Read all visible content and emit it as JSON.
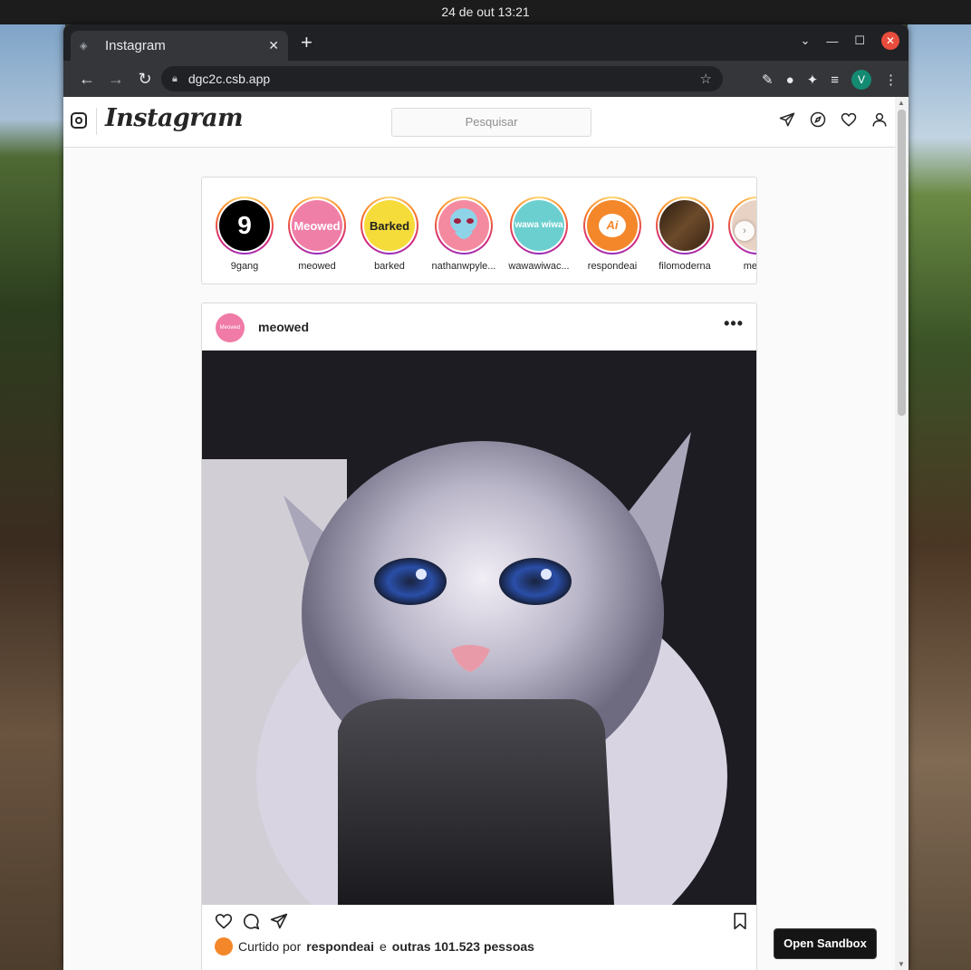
{
  "system": {
    "clock": "24 de out  13:21"
  },
  "browser": {
    "tab_title": "Instagram",
    "tab_close": "✕",
    "new_tab": "+",
    "url": "dgc2c.csb.app",
    "profile_initial": "V"
  },
  "instagram": {
    "brand": "Instagram",
    "search_placeholder": "Pesquisar",
    "stories": [
      {
        "name": "9gang",
        "label": "9",
        "bg": "#000000"
      },
      {
        "name": "meowed",
        "label": "Meowed",
        "bg": "#f07fa8"
      },
      {
        "name": "barked",
        "label": "Barked",
        "bg": "#f6dc3a"
      },
      {
        "name": "nathanwpyle...",
        "label": "",
        "bg": "#f48aa0"
      },
      {
        "name": "wawawiwac...",
        "label": "wawa wiwa",
        "bg": "#6ccfcf"
      },
      {
        "name": "respondeai",
        "label": "Ai",
        "bg": "#f4872a"
      },
      {
        "name": "filomoderna",
        "label": "",
        "bg": "#5a3a1e"
      },
      {
        "name": "meme",
        "label": "",
        "bg": "#e8d2c4"
      }
    ],
    "post": {
      "avatar_text": "Meowed",
      "username": "meowed",
      "more": "•••",
      "liked_prefix": "Curtido por",
      "liked_user": "respondeai",
      "liked_mid": "e",
      "liked_others": "outras 101.523 pessoas"
    }
  },
  "sandbox_button": "Open Sandbox"
}
